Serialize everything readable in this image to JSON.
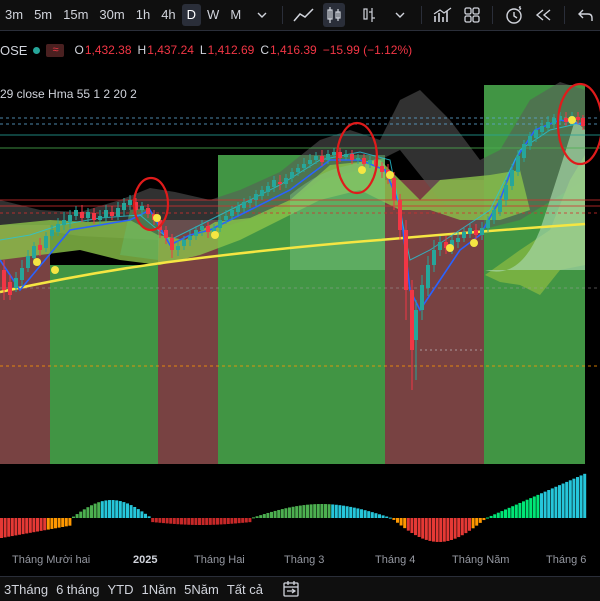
{
  "toolbar": {
    "timeframes": [
      {
        "label": "3m",
        "active": false
      },
      {
        "label": "5m",
        "active": false
      },
      {
        "label": "15m",
        "active": false
      },
      {
        "label": "30m",
        "active": false
      },
      {
        "label": "1h",
        "active": false
      },
      {
        "label": "4h",
        "active": false
      },
      {
        "label": "D",
        "active": true
      },
      {
        "label": "W",
        "active": false
      },
      {
        "label": "M",
        "active": false
      }
    ],
    "icons": [
      "timeframe-dropdown-icon",
      "line-chart-icon",
      "candles-icon",
      "bars-type-icon",
      "chart-type-dropdown-icon",
      "indicators-icon",
      "templates-icon",
      "alert-icon",
      "replay-icon",
      "undo-icon"
    ]
  },
  "legend": {
    "symbol": "OSE",
    "open_key": "O",
    "open": "1,432.38",
    "high_key": "H",
    "high": "1,437.24",
    "low_key": "L",
    "low": "1,412.69",
    "close_key": "C",
    "close": "1,416.39",
    "change": "−15.99 (−1.12%)",
    "indicator": "29 close Hma 55 1 2 20 2"
  },
  "colors": {
    "up": "#26a69a",
    "down": "#f23645",
    "bull_zone": "#4caf50",
    "bear_zone": "#a05858",
    "ma_line": "#f5e642",
    "hma_line": "#2962ff",
    "marker": "#f5e642",
    "highlight_circle": "#e01b1b"
  },
  "xaxis": {
    "labels": [
      {
        "text": "Tháng Mười hai",
        "bold": false
      },
      {
        "text": "2025",
        "bold": true
      },
      {
        "text": "Tháng Hai",
        "bold": false
      },
      {
        "text": "Tháng 3",
        "bold": false
      },
      {
        "text": "Tháng 4",
        "bold": false
      },
      {
        "text": "Tháng Năm",
        "bold": false
      },
      {
        "text": "Tháng 6",
        "bold": false
      }
    ]
  },
  "bottombar": {
    "ranges": [
      "3Tháng",
      "6 tháng",
      "YTD",
      "1Năm",
      "5Năm",
      "Tất cả"
    ],
    "icon": "calendar-range-icon"
  }
}
